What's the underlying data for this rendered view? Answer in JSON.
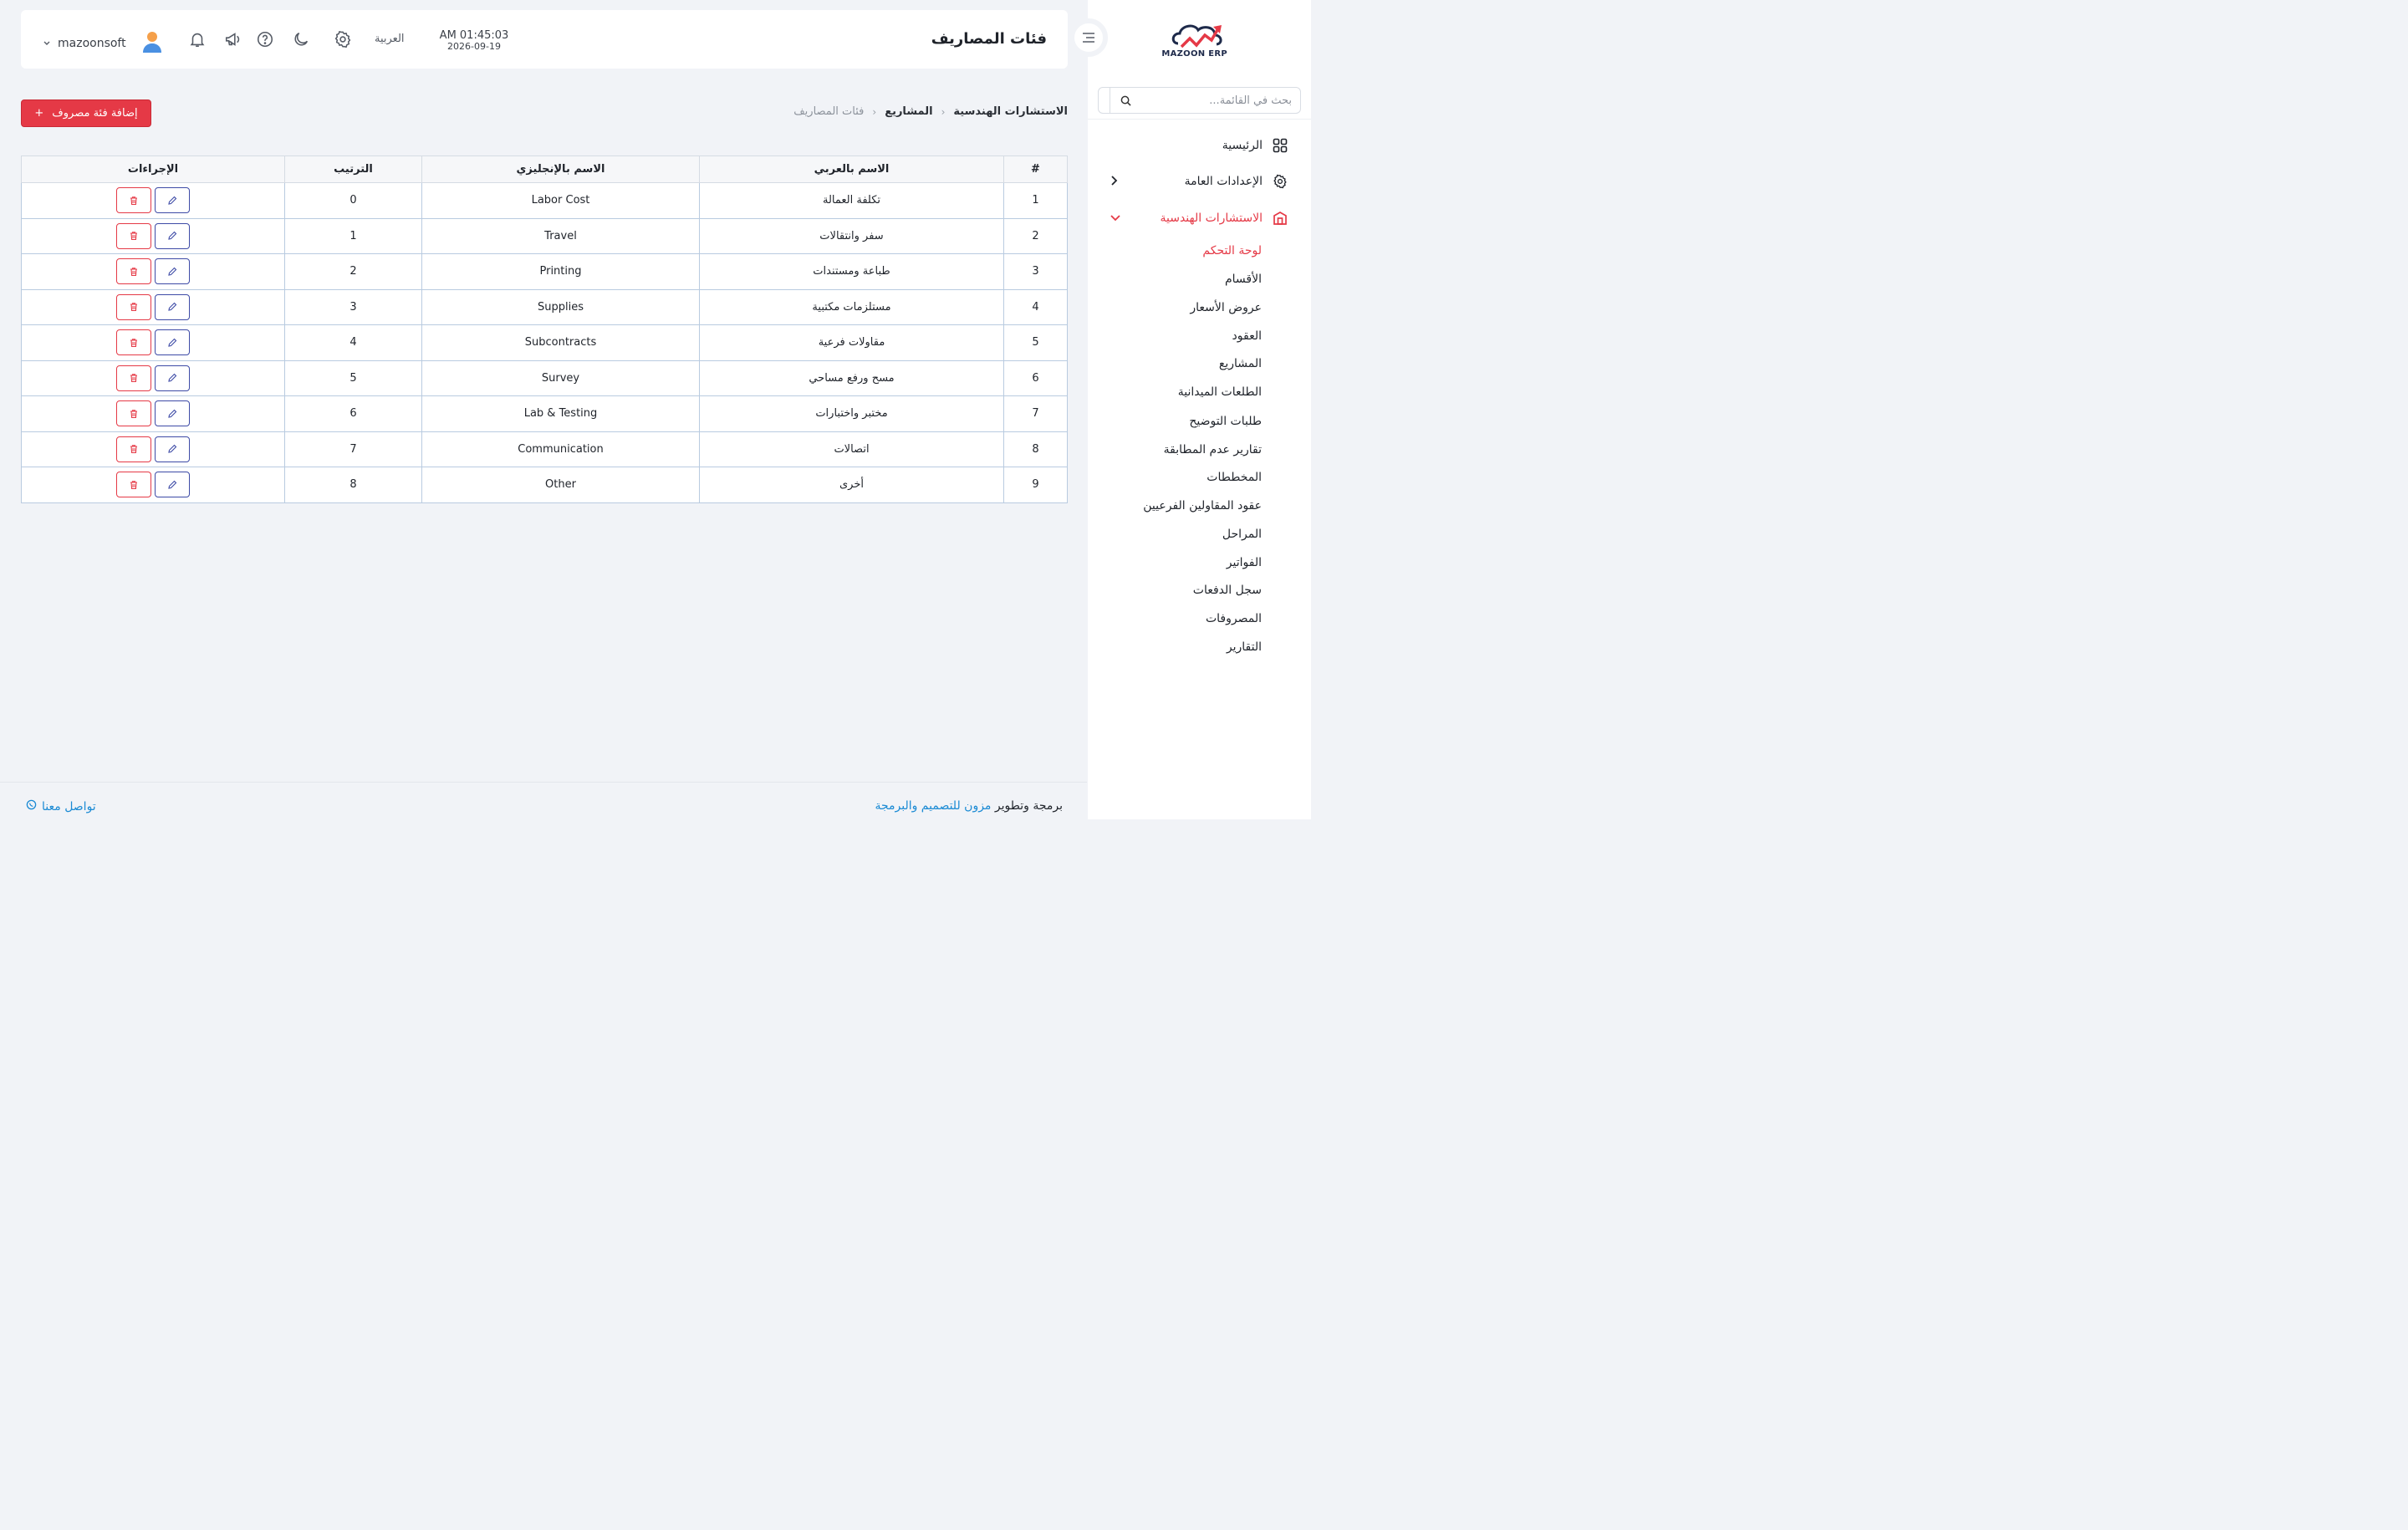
{
  "sidebar": {
    "logo_text": "MAZOON ERP",
    "search_placeholder": "بحث في القائمة...",
    "items": [
      {
        "label": "الرئيسية",
        "icon": "grid-icon"
      },
      {
        "label": "الإعدادات العامة",
        "icon": "gear-icon"
      },
      {
        "label": "الاستشارات الهندسية",
        "icon": "building-icon"
      }
    ],
    "sub_items": [
      "لوحة التحكم",
      "الأقسام",
      "عروض الأسعار",
      "العقود",
      "المشاريع",
      "الطلعات الميدانية",
      "طلبات التوضيح",
      "تقارير عدم المطابقة",
      "المخططات",
      "عقود المقاولين الفرعيين",
      "المراحل",
      "الفواتير",
      "سجل الدفعات",
      "المصروفات",
      "التقارير"
    ],
    "accent_color": "#e53946"
  },
  "header": {
    "title": "فئات المصاريف",
    "time": "AM 01:45:03",
    "date": "2026-09-19",
    "language": "العربية",
    "username": "mazoonsoft"
  },
  "breadcrumb": {
    "level1": "الاستشارات الهندسية",
    "level2": "المشاريع",
    "current": "فئات المصاريف"
  },
  "add_button_label": "إضافة فئة مصروف",
  "table": {
    "headers": [
      "#",
      "الاسم بالعربي",
      "الاسم بالإنجليزي",
      "الترتيب",
      "الإجراءات"
    ],
    "rows": [
      {
        "num": "1",
        "ar": "تكلفة العمالة",
        "en": "Labor Cost",
        "order": "0"
      },
      {
        "num": "2",
        "ar": "سفر وانتقالات",
        "en": "Travel",
        "order": "1"
      },
      {
        "num": "3",
        "ar": "طباعة ومستندات",
        "en": "Printing",
        "order": "2"
      },
      {
        "num": "4",
        "ar": "مستلزمات مكتبية",
        "en": "Supplies",
        "order": "3"
      },
      {
        "num": "5",
        "ar": "مقاولات فرعية",
        "en": "Subcontracts",
        "order": "4"
      },
      {
        "num": "6",
        "ar": "مسح ورفع مساحي",
        "en": "Survey",
        "order": "5"
      },
      {
        "num": "7",
        "ar": "مختبر واختبارات",
        "en": "Lab & Testing",
        "order": "6"
      },
      {
        "num": "8",
        "ar": "اتصالات",
        "en": "Communication",
        "order": "7"
      },
      {
        "num": "9",
        "ar": "أخرى",
        "en": "Other",
        "order": "8"
      }
    ]
  },
  "footer": {
    "prefix": "برمجة وتطوير",
    "brand": "مزون للتصميم والبرمجة",
    "contact": "تواصل معنا"
  }
}
